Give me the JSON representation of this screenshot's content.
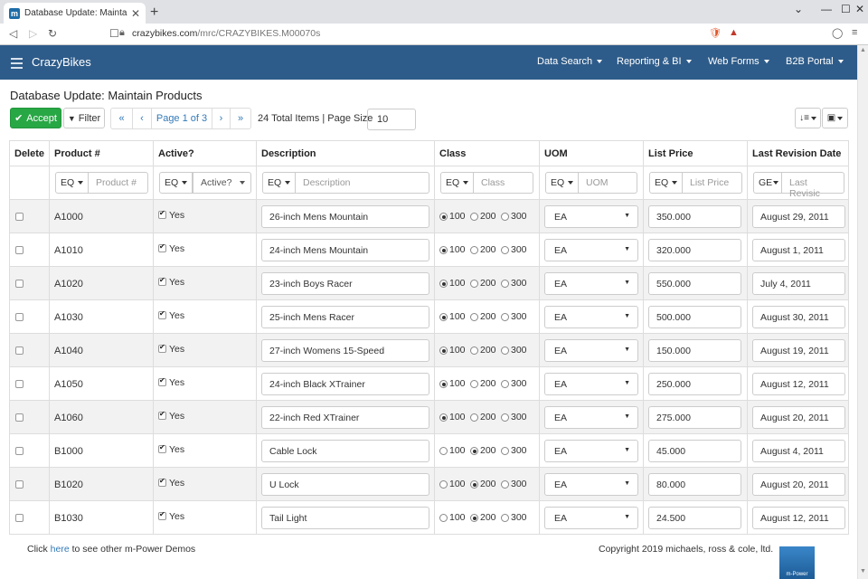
{
  "browser": {
    "tab_title": "Database Update: Maintain Produ",
    "url_host": "crazybikes.com",
    "url_path": "/mrc/CRAZYBIKES.M00070s"
  },
  "app": {
    "brand": "CrazyBikes",
    "menus": [
      "Data Search",
      "Reporting & BI",
      "Web Forms",
      "B2B Portal"
    ]
  },
  "page": {
    "title": "Database Update: Maintain Products",
    "accept_label": "Accept",
    "filter_label": "Filter",
    "pager_label": "Page 1 of 3",
    "total_text": "24 Total Items | Page Size",
    "page_size": "10"
  },
  "grid": {
    "headers": {
      "delete": "Delete",
      "product": "Product #",
      "active": "Active?",
      "description": "Description",
      "class": "Class",
      "uom": "UOM",
      "list_price": "List Price",
      "last_revision": "Last Revision Date"
    },
    "filters": {
      "product": {
        "op": "EQ",
        "placeholder": "Product #"
      },
      "active": {
        "op": "EQ",
        "placeholder": "Active?"
      },
      "description": {
        "op": "EQ",
        "placeholder": "Description"
      },
      "class": {
        "op": "EQ",
        "placeholder": "Class"
      },
      "uom": {
        "op": "EQ",
        "placeholder": "UOM"
      },
      "list_price": {
        "op": "EQ",
        "placeholder": "List Price"
      },
      "last_revision": {
        "op": "GE",
        "placeholder": "Last Revisic"
      }
    },
    "class_options": [
      "100",
      "200",
      "300"
    ],
    "rows": [
      {
        "product": "A1000",
        "active": "Yes",
        "description": "26-inch Mens Mountain",
        "class": "100",
        "uom": "EA",
        "price": "350.000",
        "date": "August 29, 2011"
      },
      {
        "product": "A1010",
        "active": "Yes",
        "description": "24-inch Mens Mountain",
        "class": "100",
        "uom": "EA",
        "price": "320.000",
        "date": "August 1, 2011"
      },
      {
        "product": "A1020",
        "active": "Yes",
        "description": "23-inch Boys Racer",
        "class": "100",
        "uom": "EA",
        "price": "550.000",
        "date": "July 4, 2011"
      },
      {
        "product": "A1030",
        "active": "Yes",
        "description": "25-inch Mens Racer",
        "class": "100",
        "uom": "EA",
        "price": "500.000",
        "date": "August 30, 2011"
      },
      {
        "product": "A1040",
        "active": "Yes",
        "description": "27-inch Womens 15-Speed",
        "class": "100",
        "uom": "EA",
        "price": "150.000",
        "date": "August 19, 2011"
      },
      {
        "product": "A1050",
        "active": "Yes",
        "description": "24-inch Black XTrainer",
        "class": "100",
        "uom": "EA",
        "price": "250.000",
        "date": "August 12, 2011"
      },
      {
        "product": "A1060",
        "active": "Yes",
        "description": "22-inch Red XTrainer",
        "class": "100",
        "uom": "EA",
        "price": "275.000",
        "date": "August 20, 2011"
      },
      {
        "product": "B1000",
        "active": "Yes",
        "description": "Cable Lock",
        "class": "200",
        "uom": "EA",
        "price": "45.000",
        "date": "August 4, 2011"
      },
      {
        "product": "B1020",
        "active": "Yes",
        "description": "U Lock",
        "class": "200",
        "uom": "EA",
        "price": "80.000",
        "date": "August 20, 2011"
      },
      {
        "product": "B1030",
        "active": "Yes",
        "description": "Tail Light",
        "class": "200",
        "uom": "EA",
        "price": "24.500",
        "date": "August 12, 2011"
      }
    ]
  },
  "footer": {
    "click_prefix": "Click",
    "here_link": "here",
    "click_suffix": "to see other m-Power Demos",
    "copyright": "Copyright 2019 michaels, ross & cole, ltd.",
    "logo_text": "m-Power"
  },
  "colors": {
    "navbar": "#2e5c8a",
    "accept": "#28a745",
    "link": "#337ab7"
  }
}
